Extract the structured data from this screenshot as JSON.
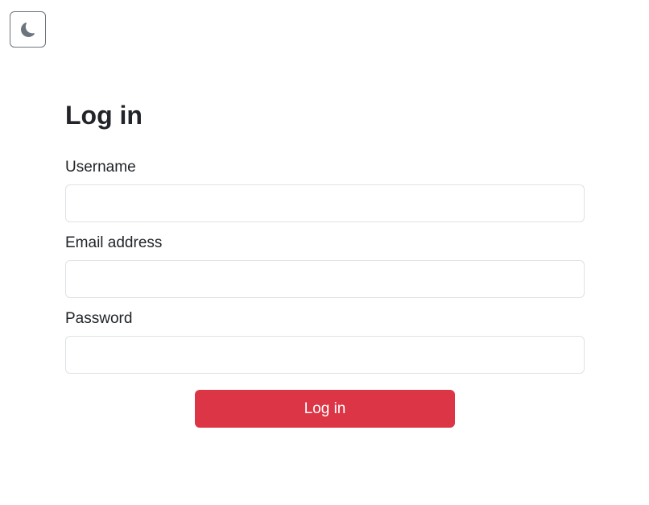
{
  "theme_toggle": {
    "icon": "moon-icon",
    "icon_color": "#6c757d"
  },
  "form": {
    "title": "Log in",
    "fields": [
      {
        "label": "Username",
        "value": "",
        "placeholder": ""
      },
      {
        "label": "Email address",
        "value": "",
        "placeholder": ""
      },
      {
        "label": "Password",
        "value": "",
        "placeholder": ""
      }
    ],
    "submit_label": "Log in",
    "accent_color": "#dc3545"
  }
}
